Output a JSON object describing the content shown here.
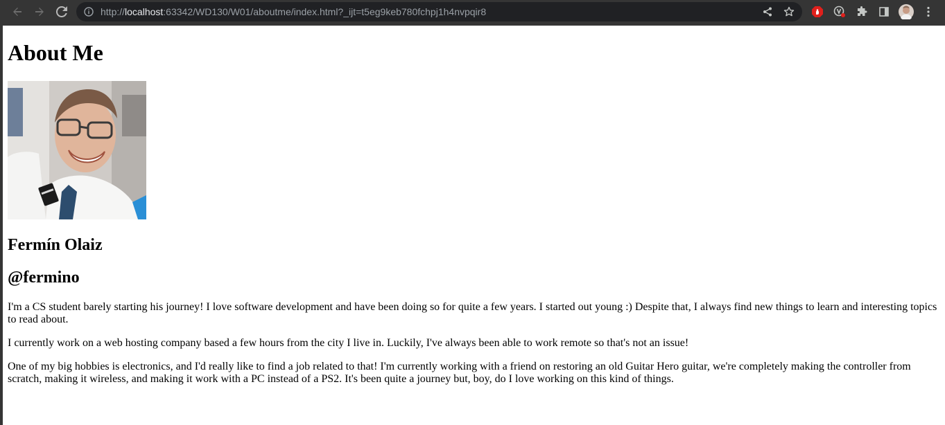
{
  "browser": {
    "url_prefix": "http://",
    "url_host": "localhost",
    "url_rest": ":63342/WD130/W01/aboutme/index.html?_ijt=t5eg9keb780fchpj1h4nvpqir8"
  },
  "page": {
    "title": "About Me",
    "name": "Fermín Olaiz",
    "handle": "@fermino",
    "paragraphs": [
      "I'm a CS student barely starting his journey! I love software development and have been doing so for quite a few years. I started out young :) Despite that, I always find new things to learn and interesting topics to read about.",
      "I currently work on a web hosting company based a few hours from the city I live in. Luckily, I've always been able to work remote so that's not an issue!",
      "One of my big hobbies is electronics, and I'd really like to find a job related to that! I'm currently working with a friend on restoring an old Guitar Hero guitar, we're completely making the controller from scratch, making it wireless, and making it work with a PC instead of a PS2. It's been quite a journey but, boy, do I love working on this kind of things."
    ]
  },
  "colors": {
    "chrome_bg": "#353535",
    "omnibox_bg": "#202124",
    "page_bg": "#ffffff",
    "adblock_red": "#e0201c"
  }
}
